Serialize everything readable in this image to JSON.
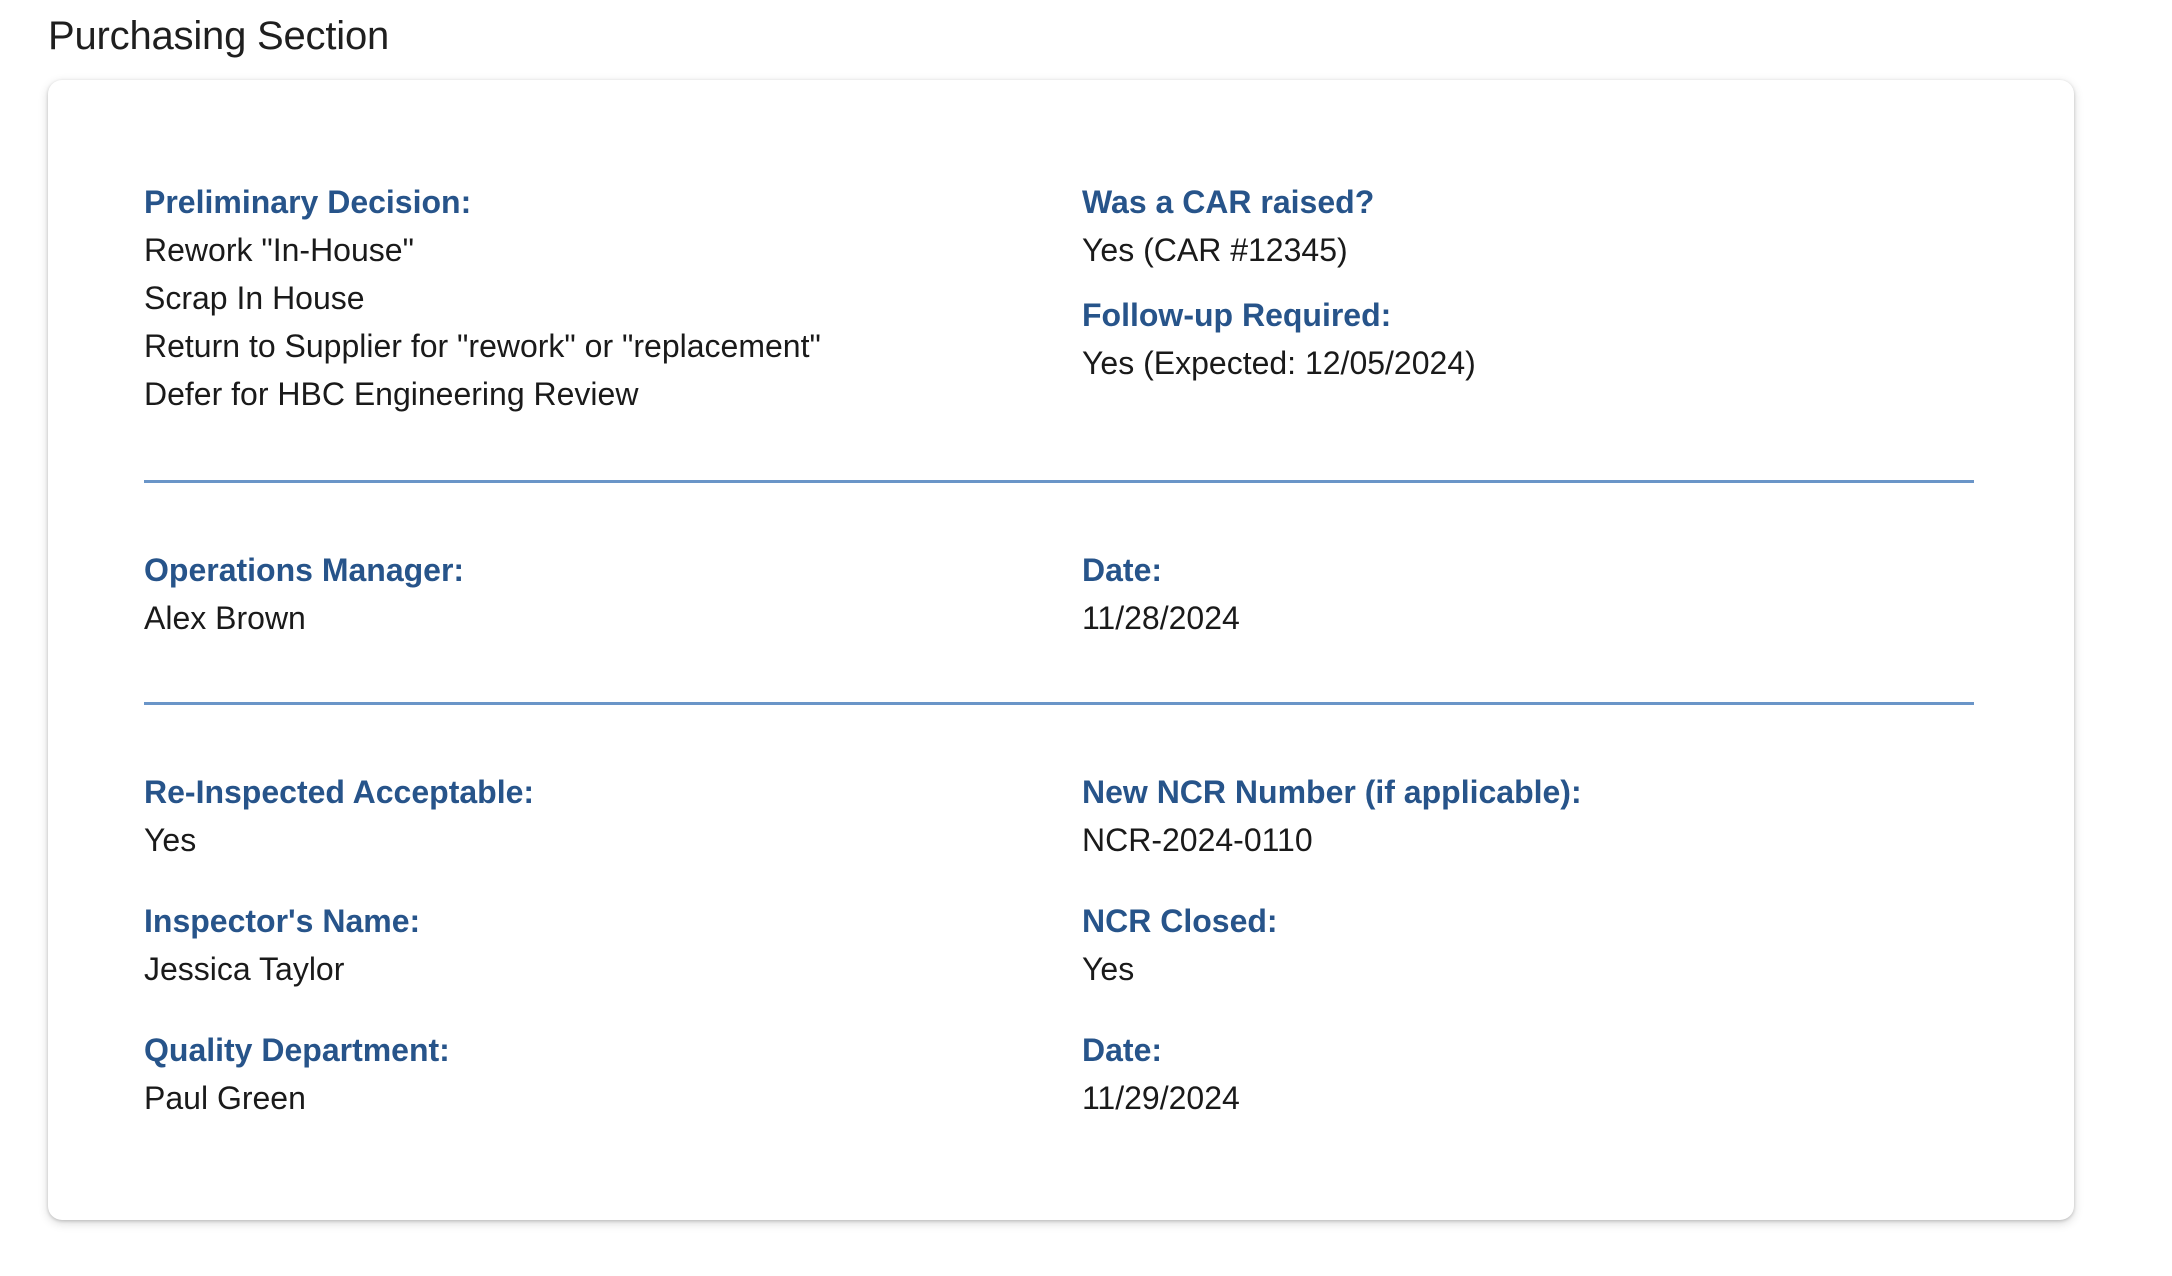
{
  "section": {
    "title": "Purchasing Section"
  },
  "preliminary_decision": {
    "label": "Preliminary Decision:",
    "options": [
      "Rework \"In-House\"",
      "Scrap In House",
      "Return to Supplier for \"rework\" or \"replacement\"",
      "Defer for HBC Engineering Review"
    ]
  },
  "car_raised": {
    "label": "Was a CAR raised?",
    "value": "Yes (CAR #12345)"
  },
  "follow_up": {
    "label": "Follow-up Required:",
    "value": "Yes (Expected: 12/05/2024)"
  },
  "operations_manager": {
    "label": "Operations Manager:",
    "value": "Alex Brown"
  },
  "operations_date": {
    "label": "Date:",
    "value": "11/28/2024"
  },
  "reinspected": {
    "label": "Re-Inspected Acceptable:",
    "value": "Yes"
  },
  "new_ncr": {
    "label": "New NCR Number (if applicable):",
    "value": "NCR-2024-0110"
  },
  "inspector": {
    "label": "Inspector's Name:",
    "value": "Jessica Taylor"
  },
  "ncr_closed": {
    "label": "NCR Closed:",
    "value": "Yes"
  },
  "quality_department": {
    "label": "Quality Department:",
    "value": "Paul Green"
  },
  "quality_date": {
    "label": "Date:",
    "value": "11/29/2024"
  },
  "colors": {
    "label": "#27548a",
    "divider": "#6a95c8",
    "text": "#1a1a1a"
  }
}
